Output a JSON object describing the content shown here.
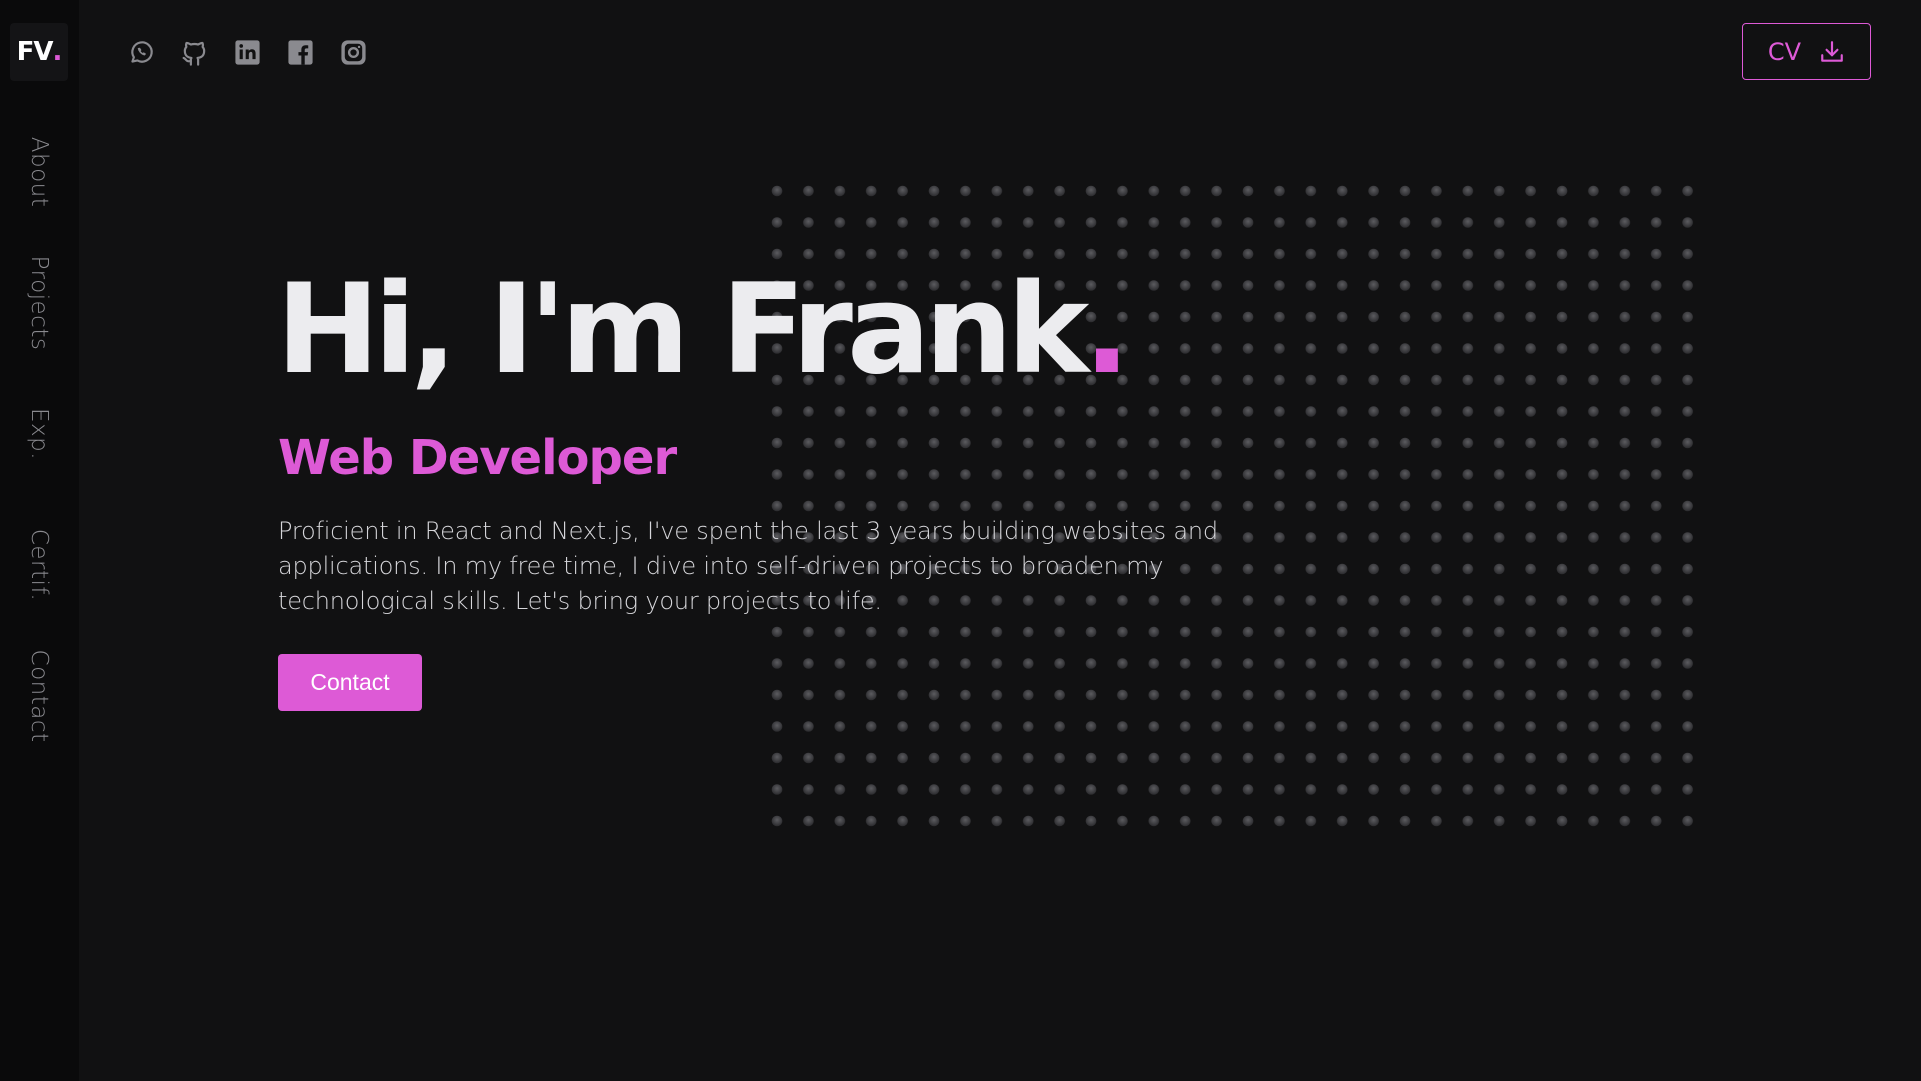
{
  "logo": {
    "text": "FV",
    "dot": "."
  },
  "sidebar": {
    "items": [
      {
        "label": "About"
      },
      {
        "label": "Projects"
      },
      {
        "label": "Exp."
      },
      {
        "label": "Certif."
      },
      {
        "label": "Contact"
      }
    ]
  },
  "socials": [
    "whatsapp-icon",
    "github-icon",
    "linkedin-icon",
    "facebook-icon",
    "instagram-icon"
  ],
  "cv_button": {
    "label": "CV",
    "icon": "download-icon"
  },
  "hero": {
    "title": "Hi, I'm Frank",
    "title_dot": ".",
    "subtitle": "Web Developer",
    "bio": "Proficient in React and Next.js, I've spent the last 3 years building websites and applications. In my free time, I dive into self-driven projects to broaden my technological skills. Let's bring your projects to life.",
    "contact_label": "Contact"
  },
  "colors": {
    "background": "#111112",
    "sidebar": "#0a0a0b",
    "accent": "#dd5ad6",
    "text": "#ececef",
    "muted": "#8a8a8f"
  }
}
